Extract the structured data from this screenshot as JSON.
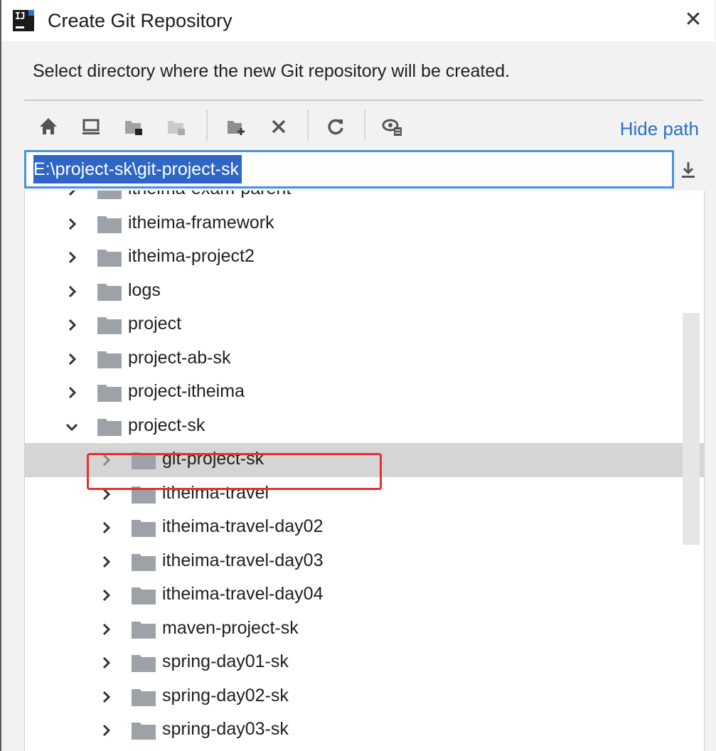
{
  "window": {
    "title": "Create Git Repository",
    "close_symbol": "✕"
  },
  "prompt": "Select directory where the new Git repository will be created.",
  "toolbar": {
    "icons": [
      "home-icon",
      "desktop-icon",
      "project-folder-icon",
      "module-folder-icon",
      "new-folder-icon",
      "delete-icon",
      "refresh-icon",
      "show-hidden-icon"
    ],
    "hide_path_label": "Hide path"
  },
  "path": {
    "value": "E:\\project-sk\\git-project-sk"
  },
  "tree": {
    "items": [
      {
        "label": "itheima-exam-parent",
        "level": 0,
        "expanded": false
      },
      {
        "label": "itheima-framework",
        "level": 0,
        "expanded": false
      },
      {
        "label": "itheima-project2",
        "level": 0,
        "expanded": false
      },
      {
        "label": "logs",
        "level": 0,
        "expanded": false
      },
      {
        "label": "project",
        "level": 0,
        "expanded": false
      },
      {
        "label": "project-ab-sk",
        "level": 0,
        "expanded": false
      },
      {
        "label": "project-itheima",
        "level": 0,
        "expanded": false
      },
      {
        "label": "project-sk",
        "level": 0,
        "expanded": true
      },
      {
        "label": "git-project-sk",
        "level": 1,
        "expanded": false,
        "selected": true
      },
      {
        "label": "itheima-travel",
        "level": 1,
        "expanded": false
      },
      {
        "label": "itheima-travel-day02",
        "level": 1,
        "expanded": false
      },
      {
        "label": "itheima-travel-day03",
        "level": 1,
        "expanded": false
      },
      {
        "label": "itheima-travel-day04",
        "level": 1,
        "expanded": false
      },
      {
        "label": "maven-project-sk",
        "level": 1,
        "expanded": false
      },
      {
        "label": "spring-day01-sk",
        "level": 1,
        "expanded": false
      },
      {
        "label": "spring-day02-sk",
        "level": 1,
        "expanded": false
      },
      {
        "label": "spring-day03-sk",
        "level": 1,
        "expanded": false
      }
    ]
  },
  "colors": {
    "accent": "#2f65c4",
    "link": "#2a6fc9",
    "highlight_border": "#e53030",
    "selection_row": "#d5d5d5"
  }
}
